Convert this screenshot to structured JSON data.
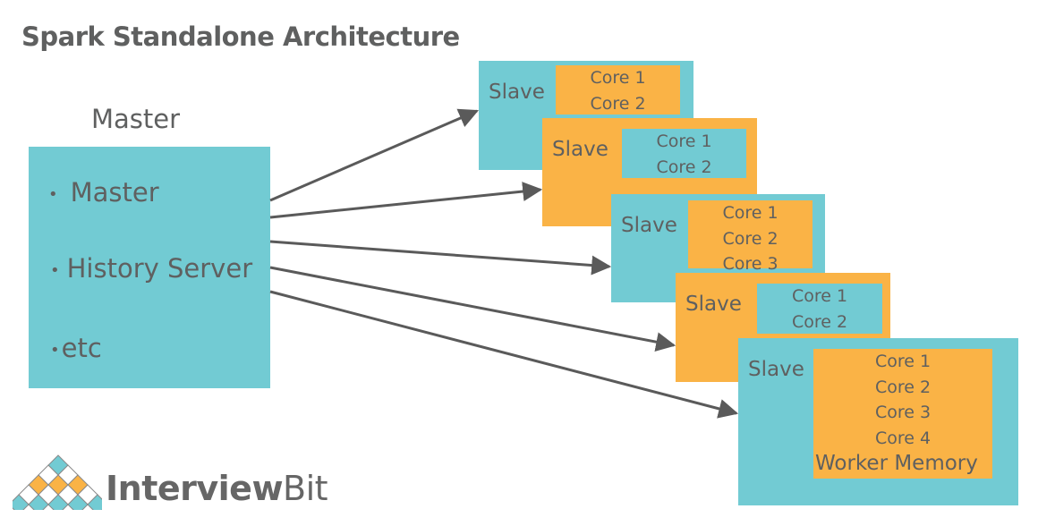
{
  "title": "Spark Standalone Architecture",
  "master": {
    "caption": "Master",
    "items": [
      "Master",
      "History Server",
      "etc"
    ]
  },
  "slaves": [
    {
      "label": "Slave",
      "color": "teal",
      "inner_color": "orange",
      "cores": [
        "Core 1",
        "Core 2"
      ]
    },
    {
      "label": "Slave",
      "color": "orange",
      "inner_color": "teal",
      "cores": [
        "Core 1",
        "Core 2"
      ]
    },
    {
      "label": "Slave",
      "color": "teal",
      "inner_color": "orange",
      "cores": [
        "Core 1",
        "Core 2",
        "Core 3"
      ]
    },
    {
      "label": "Slave",
      "color": "orange",
      "inner_color": "teal",
      "cores": [
        "Core 1",
        "Core 2"
      ]
    },
    {
      "label": "Slave",
      "color": "teal",
      "inner_color": "orange",
      "cores": [
        "Core 1",
        "Core 2",
        "Core 3",
        "Core 4"
      ],
      "memory": "Worker Memory"
    }
  ],
  "edges": [
    {
      "from": "master",
      "to": "slave-1"
    },
    {
      "from": "master",
      "to": "slave-2"
    },
    {
      "from": "master",
      "to": "slave-3"
    },
    {
      "from": "master",
      "to": "slave-4"
    },
    {
      "from": "master",
      "to": "slave-5"
    }
  ],
  "colors": {
    "teal": "#72cbd3",
    "orange": "#fab346",
    "text": "#5f6060",
    "arrow": "#5a5a5a"
  },
  "logo": {
    "bold": "Interview",
    "light": "Bit"
  }
}
